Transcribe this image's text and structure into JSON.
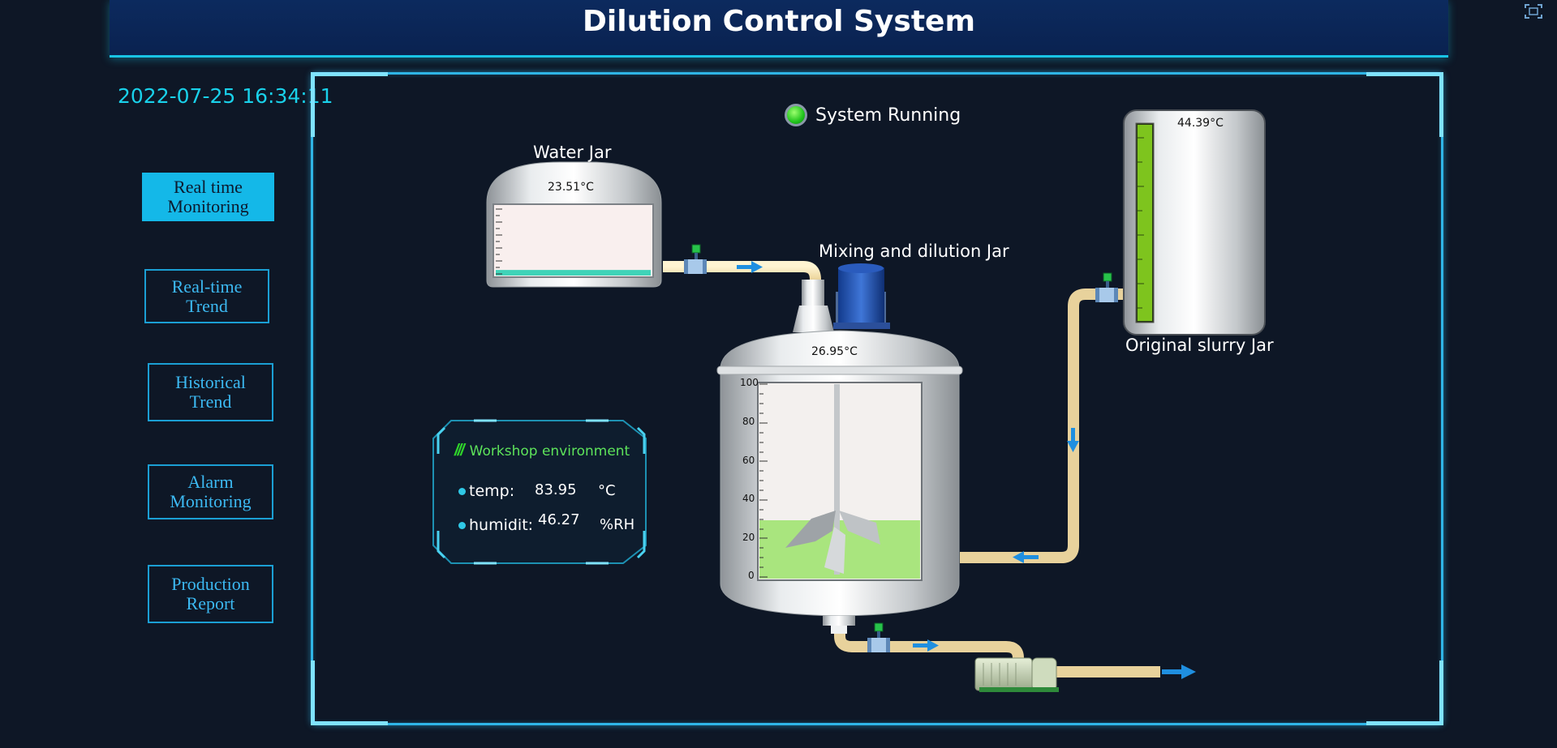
{
  "header": {
    "title": "Dilution Control System"
  },
  "clock": "2022-07-25 16:34:11",
  "nav": [
    {
      "line1": "Real time",
      "line2": "Monitoring"
    },
    {
      "line1": "Real-time",
      "line2": "Trend"
    },
    {
      "line1": "Historical",
      "line2": "Trend"
    },
    {
      "line1": "Alarm",
      "line2": "Monitoring"
    },
    {
      "line1": "Production",
      "line2": "Report"
    }
  ],
  "status": {
    "text": "System Running",
    "color": "#20c41d"
  },
  "water_jar": {
    "label": "Water Jar",
    "temp": "23.51",
    "unit": "°C",
    "level": 0.08
  },
  "mixing_jar": {
    "label": "Mixing and dilution Jar",
    "temp": "26.95",
    "unit": "°C",
    "level": 0.3,
    "scale": [
      "100",
      "80",
      "60",
      "40",
      "20",
      "0"
    ]
  },
  "slurry_jar": {
    "label": "Original slurry Jar",
    "temp": "44.39",
    "unit": "°C",
    "level": 1.0
  },
  "environment": {
    "title": "Workshop environment",
    "slashes": "///",
    "temp": {
      "label": "temp:",
      "value": "83.95",
      "unit": "°C"
    },
    "humidity": {
      "label": "humidit:",
      "value": "46.27",
      "unit": "%RH"
    }
  },
  "icons": [
    "fullscreen-icon",
    "status-indicator-icon"
  ],
  "colors": {
    "accent": "#19c4e6",
    "pipe": "#f1deae",
    "liquid_water": "#3fd3b8",
    "liquid_mix": "#a9e57e",
    "liquid_slurry": "#7ec41e",
    "arrow": "#1f8fe0"
  }
}
